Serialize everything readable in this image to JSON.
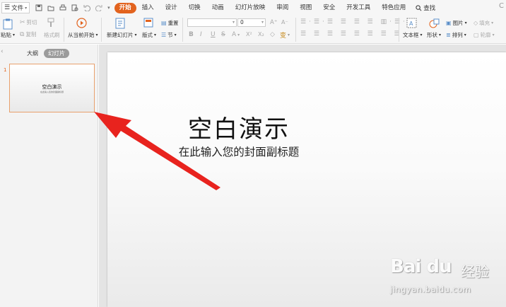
{
  "menu": {
    "file_label": "文件",
    "tabs": [
      "开始",
      "插入",
      "设计",
      "切换",
      "动画",
      "幻灯片放映",
      "审阅",
      "视图",
      "安全",
      "开发工具",
      "特色应用"
    ],
    "active_tab": "开始",
    "search_label": "查找"
  },
  "ribbon": {
    "paste": "粘贴",
    "cut": "剪切",
    "copy": "复制",
    "format_painter": "格式刷",
    "play_from_current": "从当前开始",
    "new_slide": "新建幻灯片",
    "layout": "版式",
    "reset": "重置",
    "section": "节",
    "font_size_value": "0",
    "font_styles": [
      "B",
      "I",
      "U",
      "S",
      "A",
      "X²",
      "X₂"
    ],
    "font_grow": "A⁺",
    "font_shrink": "A⁻",
    "textbox": "文本框",
    "shape": "形状",
    "picture": "图片",
    "fill": "填充",
    "arrange": "排列",
    "outline": "轮廓"
  },
  "left_pane": {
    "tab_outline": "大纲",
    "tab_slides": "幻灯片",
    "slide_number": "1",
    "thumb_title": "空白演示",
    "thumb_subtitle": "在此输入您的封面副标题"
  },
  "slide": {
    "title": "空白演示",
    "subtitle": "在此输入您的封面副标题"
  },
  "watermark": {
    "logo": "Bai du",
    "brand": "经验",
    "url": "jingyan.baidu.com"
  },
  "colors": {
    "accent": "#e2631e",
    "arrow": "#e8231e",
    "thumb_border": "#e8a06c"
  }
}
